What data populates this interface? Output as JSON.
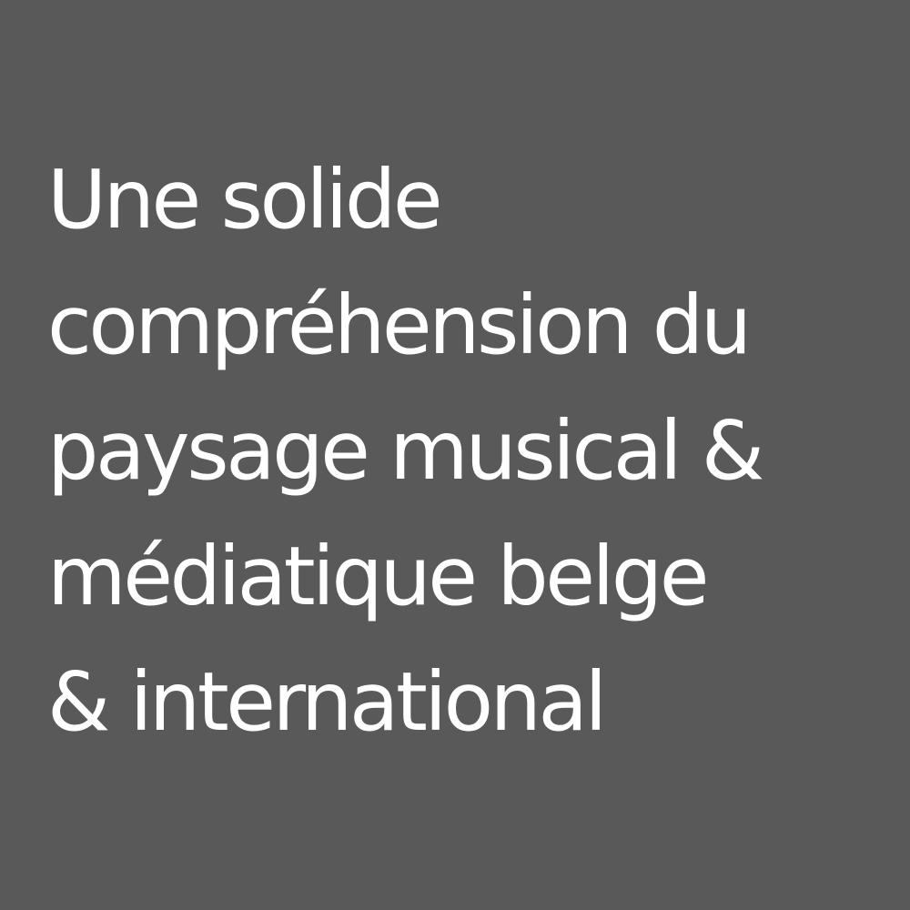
{
  "background_color": "#595959",
  "text_color": "#ffffff",
  "statement": {
    "lines": [
      "Une solide",
      "compréhension du",
      "paysage musical &",
      "médiatique belge",
      "& international"
    ]
  }
}
